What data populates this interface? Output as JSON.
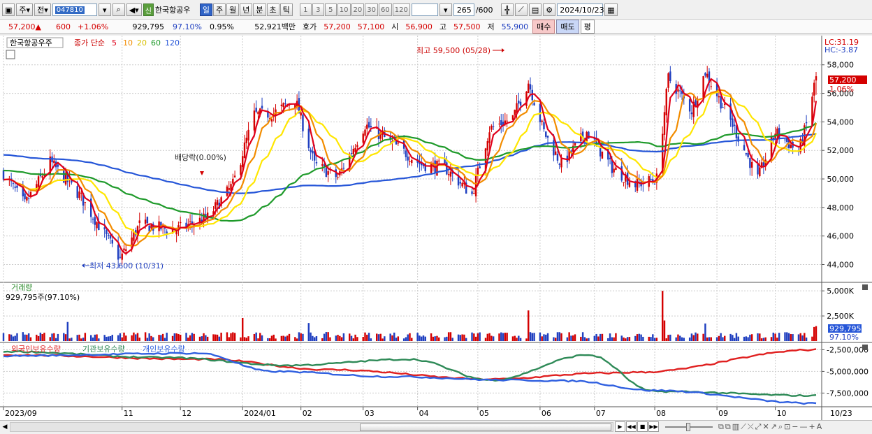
{
  "toolbar": {
    "week_label": "주",
    "prev_label": "전",
    "code": "047810",
    "tag": "신",
    "stock_name": "한국항공우",
    "periods": [
      {
        "label": "일",
        "selected": true
      },
      {
        "label": "주",
        "selected": false
      },
      {
        "label": "월",
        "selected": false
      },
      {
        "label": "년",
        "selected": false
      },
      {
        "label": "분",
        "selected": false
      },
      {
        "label": "초",
        "selected": false
      },
      {
        "label": "틱",
        "selected": false
      }
    ],
    "numbers": [
      "1",
      "3",
      "5",
      "10",
      "20",
      "30",
      "60",
      "120"
    ],
    "count": "265",
    "count_total": "/600",
    "date": "2024/10/23"
  },
  "quote": {
    "price": "57,200",
    "arrow": "▲",
    "change": "600",
    "change_pct": "+1.06%",
    "volume": "929,795",
    "vol_ratio": "97.10%",
    "turnover": "0.95%",
    "amount": "52,921백만",
    "bid_label": "호가",
    "ask": "57,200",
    "bid": "57,100",
    "open_label": "시",
    "open": "56,900",
    "high_label": "고",
    "high": "57,500",
    "low_label": "저",
    "low": "55,900",
    "buy_label": "매수",
    "sell_label": "매도",
    "flat_label": "평"
  },
  "colors": {
    "up": "#d40000",
    "down": "#1f3fc0",
    "ma5": "#e0001a",
    "ma10": "#f28c00",
    "ma20": "#ffe600",
    "ma60": "#1e9a2a",
    "ma120": "#2656d8",
    "foreign": "#e02020",
    "inst": "#2e8a57",
    "indiv": "#3060e0"
  },
  "chart_data": [
    {
      "type": "candlestick",
      "title": "한국항공우주",
      "legend_prefix": "종가 단순",
      "ma_labels": [
        "5",
        "10",
        "20",
        "60",
        "120"
      ],
      "ylim": [
        42800,
        59800
      ],
      "yticks": [
        "58,000",
        "56,000",
        "54,000",
        "52,000",
        "50,000",
        "48,000",
        "46,000",
        "44,000"
      ],
      "ytick_values": [
        58000,
        56000,
        54000,
        52000,
        50000,
        48000,
        46000,
        44000
      ],
      "lc": "LC:31.19",
      "hc": "HC:-3.87",
      "current_price": "57,200",
      "current_pct": "1.06%",
      "annotations": {
        "high": "최고 59,500 (05/28)",
        "low": "최저 43,600 (10/31)",
        "dividend": "배당락(0.00%)"
      },
      "keypoints": [
        {
          "d": "2023-09-01",
          "p": 50400
        },
        {
          "d": "2023-09-12",
          "p": 48200
        },
        {
          "d": "2023-09-25",
          "p": 51200
        },
        {
          "d": "2023-10-10",
          "p": 48900
        },
        {
          "d": "2023-10-31",
          "p": 44400
        },
        {
          "d": "2023-11-10",
          "p": 46800
        },
        {
          "d": "2023-11-28",
          "p": 46400
        },
        {
          "d": "2023-12-15",
          "p": 47300
        },
        {
          "d": "2023-12-28",
          "p": 49600
        },
        {
          "d": "2024-01-08",
          "p": 54500
        },
        {
          "d": "2024-01-18",
          "p": 54600
        },
        {
          "d": "2024-01-29",
          "p": 55600
        },
        {
          "d": "2024-02-08",
          "p": 51000
        },
        {
          "d": "2024-02-20",
          "p": 50100
        },
        {
          "d": "2024-03-05",
          "p": 53800
        },
        {
          "d": "2024-03-20",
          "p": 52400
        },
        {
          "d": "2024-04-03",
          "p": 51000
        },
        {
          "d": "2024-04-15",
          "p": 50800
        },
        {
          "d": "2024-04-29",
          "p": 48900
        },
        {
          "d": "2024-05-08",
          "p": 53500
        },
        {
          "d": "2024-05-20",
          "p": 54300
        },
        {
          "d": "2024-05-28",
          "p": 56800
        },
        {
          "d": "2024-06-05",
          "p": 53300
        },
        {
          "d": "2024-06-14",
          "p": 51000
        },
        {
          "d": "2024-06-27",
          "p": 53300
        },
        {
          "d": "2024-07-10",
          "p": 50800
        },
        {
          "d": "2024-07-22",
          "p": 49600
        },
        {
          "d": "2024-08-02",
          "p": 50000
        },
        {
          "d": "2024-08-08",
          "p": 57100
        },
        {
          "d": "2024-08-20",
          "p": 54800
        },
        {
          "d": "2024-08-27",
          "p": 57500
        },
        {
          "d": "2024-09-10",
          "p": 53800
        },
        {
          "d": "2024-09-23",
          "p": 50000
        },
        {
          "d": "2024-10-02",
          "p": 53300
        },
        {
          "d": "2024-10-14",
          "p": 51900
        },
        {
          "d": "2024-10-18",
          "p": 53800
        },
        {
          "d": "2024-10-23",
          "p": 57200
        }
      ],
      "ohlc_latest": {
        "open": 56900,
        "high": 57500,
        "low": 55900,
        "close": 57200
      }
    },
    {
      "type": "bar",
      "title": "거래량",
      "readout": "929,795주(97.10%)",
      "yticks": [
        "5,000K",
        "2,500K"
      ],
      "ytick_values": [
        5000,
        2500
      ],
      "ylim": [
        0,
        5500
      ],
      "unit": "K",
      "current": "929,795",
      "current_pct": "97.10%",
      "spikes": [
        {
          "d": "2023-10-04",
          "v": 1900
        },
        {
          "d": "2024-01-02",
          "v": 2300
        },
        {
          "d": "2024-02-05",
          "v": 1800
        },
        {
          "d": "2024-05-28",
          "v": 3050
        },
        {
          "d": "2024-08-05",
          "v": 5000
        },
        {
          "d": "2024-08-06",
          "v": 2050
        },
        {
          "d": "2024-08-27",
          "v": 1750
        },
        {
          "d": "2024-10-22",
          "v": 1400
        }
      ]
    },
    {
      "type": "line",
      "series": [
        {
          "name": "외국인보유수량",
          "points": [
            [
              0,
              -3100000
            ],
            [
              0.25,
              -3600000
            ],
            [
              0.4,
              -4800000
            ],
            [
              0.6,
              -5900000
            ],
            [
              0.74,
              -5200000
            ],
            [
              0.78,
              -5100000
            ],
            [
              1,
              -2500000
            ]
          ]
        },
        {
          "name": "기관보유수량",
          "points": [
            [
              0,
              -2700000
            ],
            [
              0.2,
              -3400000
            ],
            [
              0.35,
              -4300000
            ],
            [
              0.5,
              -3600000
            ],
            [
              0.6,
              -6000000
            ],
            [
              0.72,
              -3100000
            ],
            [
              0.8,
              -7300000
            ],
            [
              1,
              -7800000
            ]
          ]
        },
        {
          "name": "개인보유수량",
          "points": [
            [
              0,
              -3200000
            ],
            [
              0.24,
              -2900000
            ],
            [
              0.33,
              -5000000
            ],
            [
              0.48,
              -5600000
            ],
            [
              0.62,
              -6000000
            ],
            [
              0.7,
              -6100000
            ],
            [
              0.8,
              -7200000
            ],
            [
              1,
              -8700000
            ]
          ]
        }
      ],
      "yticks": [
        "-2,500,000",
        "-5,000,000",
        "-7,500,000"
      ],
      "ytick_values": [
        -2500000,
        -5000000,
        -7500000
      ],
      "ylim": [
        -9000000,
        -1900000
      ]
    }
  ],
  "xaxis": {
    "labels": [
      "2023/09",
      "11",
      "12",
      "2024/01",
      "02",
      "03",
      "04",
      "05",
      "06",
      "07",
      "08",
      "09",
      "10"
    ],
    "label_dates": [
      "2023-09-01",
      "2023-11-01",
      "2023-12-01",
      "2024-01-02",
      "2024-02-01",
      "2024-03-04",
      "2024-04-01",
      "2024-05-02",
      "2024-06-03",
      "2024-07-01",
      "2024-08-01",
      "2024-09-02",
      "2024-10-02"
    ],
    "cursor_label": "10/23"
  }
}
